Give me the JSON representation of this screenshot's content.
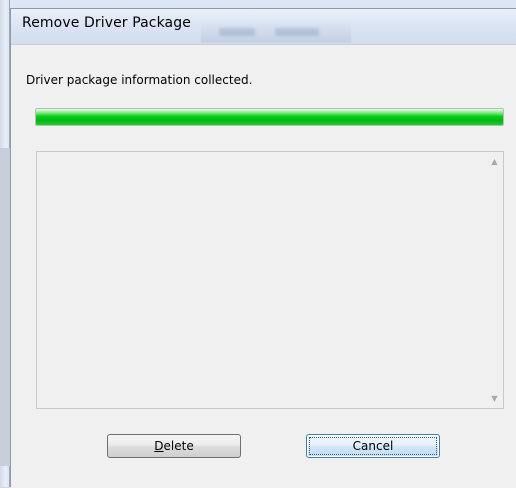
{
  "window": {
    "title": "Remove Driver Package",
    "background_tabs": [
      "Security",
      "Advanced"
    ]
  },
  "status": {
    "message": "Driver package information collected."
  },
  "progress": {
    "value_percent": 100,
    "color": "#06d218"
  },
  "details_list": {
    "items": []
  },
  "scrollbar": {
    "up_icon": "triangle-up",
    "down_icon": "triangle-down"
  },
  "buttons": {
    "delete": {
      "label_prefix": "",
      "mnemonic": "D",
      "label_suffix": "elete"
    },
    "cancel": {
      "label": "Cancel"
    }
  },
  "colors": {
    "dialog_background": "#f0f0f0",
    "titlebar_top": "#e9f0fa",
    "titlebar_bottom": "#d2dded",
    "button_focus_border": "#3c7fb1",
    "progress_green": "#06d218"
  }
}
